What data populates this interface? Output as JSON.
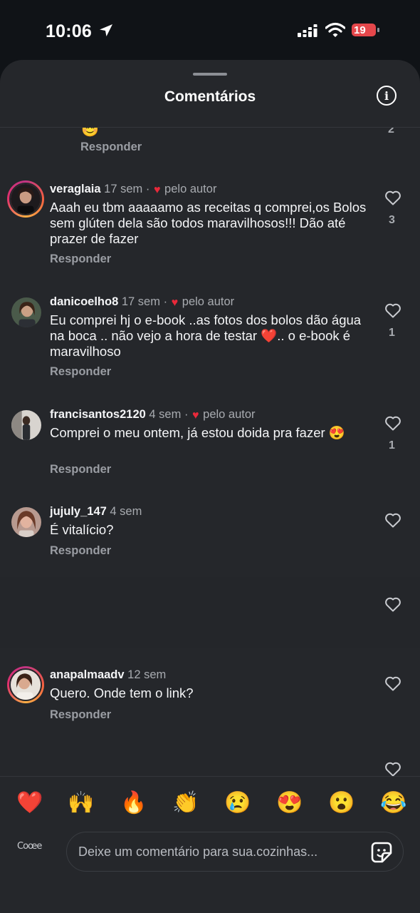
{
  "status_bar": {
    "time": "10:06",
    "battery": "19"
  },
  "sheet": {
    "title": "Comentários"
  },
  "partial_comment": {
    "emoji": "😊",
    "like_count": "2",
    "reply_label": "Responder"
  },
  "comments": [
    {
      "username": "veraglaia",
      "time": "17 sem",
      "liked_by_author": "pelo autor",
      "text": "Aaah eu tbm aaaaamo as receitas q comprei,os Bolos sem glúten dela  são todos maravilhosos!!! Dão até prazer de fazer",
      "reply_label": "Responder",
      "like_count": "3"
    },
    {
      "username": "danicoelho8",
      "time": "17 sem",
      "liked_by_author": "pelo autor",
      "text": "Eu  comprei hj o e-book ..as fotos dos bolos dão água na boca .. não vejo a hora de testar ❤️.. o e-book é maravilhoso",
      "reply_label": "Responder",
      "like_count": "1"
    },
    {
      "username": "francisantos2120",
      "time": "4 sem",
      "liked_by_author": "pelo autor",
      "text": "Comprei o meu ontem, já estou doida pra fazer 😍",
      "reply_label": "Responder",
      "like_count": "1"
    },
    {
      "username": "jujuly_147",
      "time": "4 sem",
      "text": "É vitalício?",
      "reply_label": "Responder"
    },
    {
      "username": "anapalmaadv",
      "time": "12 sem",
      "text": "Quero. Onde tem o link?",
      "reply_label": "Responder"
    }
  ],
  "reactions": [
    "❤️",
    "🙌",
    "🔥",
    "👏",
    "😢",
    "😍",
    "😮",
    "😂"
  ],
  "composer": {
    "avatar_text": "Coœe",
    "placeholder": "Deixe um comentário para sua.cozinhas..."
  },
  "colors": {
    "background": "#101317",
    "sheet": "#25272b",
    "heart": "#e8293a",
    "secondary_text": "#a8abb0"
  }
}
